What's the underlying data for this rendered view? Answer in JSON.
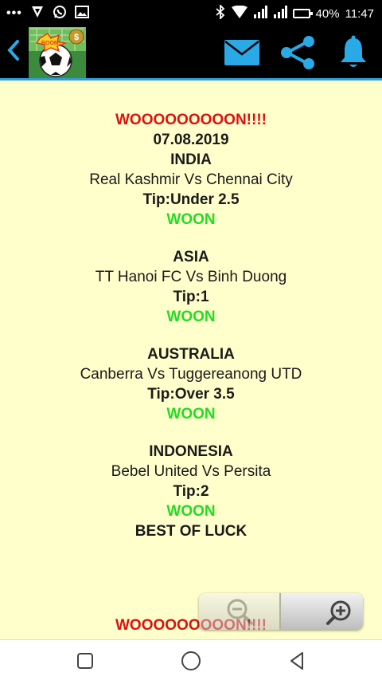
{
  "status_bar": {
    "overflow_dots": "•••",
    "battery_percent": "40%",
    "time": "11:47",
    "icons": [
      "vpn-icon",
      "whatsapp-icon",
      "image-icon",
      "bluetooth-icon",
      "wifi-icon",
      "signal-icon",
      "signal-icon",
      "battery-icon"
    ]
  },
  "app_bar": {
    "back_icon": "chevron-left-icon",
    "logo_text": "BOOM!",
    "actions": [
      "mail-icon",
      "share-icon",
      "bell-icon"
    ]
  },
  "colors": {
    "content_bg": "#ffffcc",
    "accent_blue": "#29a9e6",
    "win_red": "#dd1111",
    "woon_green": "#22dd22"
  },
  "content": {
    "header": "WOOOOOOOOON!!!!",
    "date": "07.08.2019",
    "tips": [
      {
        "country": "INDIA",
        "match": "Real Kashmir Vs Chennai City",
        "tip": "Tip:Under 2.5",
        "result": "WOON"
      },
      {
        "country": "ASIA",
        "match": "TT Hanoi FC Vs Binh Duong",
        "tip": "Tip:1",
        "result": "WOON"
      },
      {
        "country": "AUSTRALIA",
        "match": "Canberra Vs Tuggereanong UTD",
        "tip": "Tip:Over 3.5",
        "result": "WOON"
      },
      {
        "country": "INDONESIA",
        "match": "Bebel United Vs Persita",
        "tip": "Tip:2",
        "result": "WOON"
      }
    ],
    "footer": "BEST OF LUCK",
    "next_header": "WOOOOOOOOON!!!!"
  },
  "zoom": {
    "out_icon": "zoom-out-icon",
    "in_icon": "zoom-in-icon"
  },
  "nav_bar": {
    "buttons": [
      "recents-square-icon",
      "home-circle-icon",
      "back-triangle-icon"
    ]
  }
}
